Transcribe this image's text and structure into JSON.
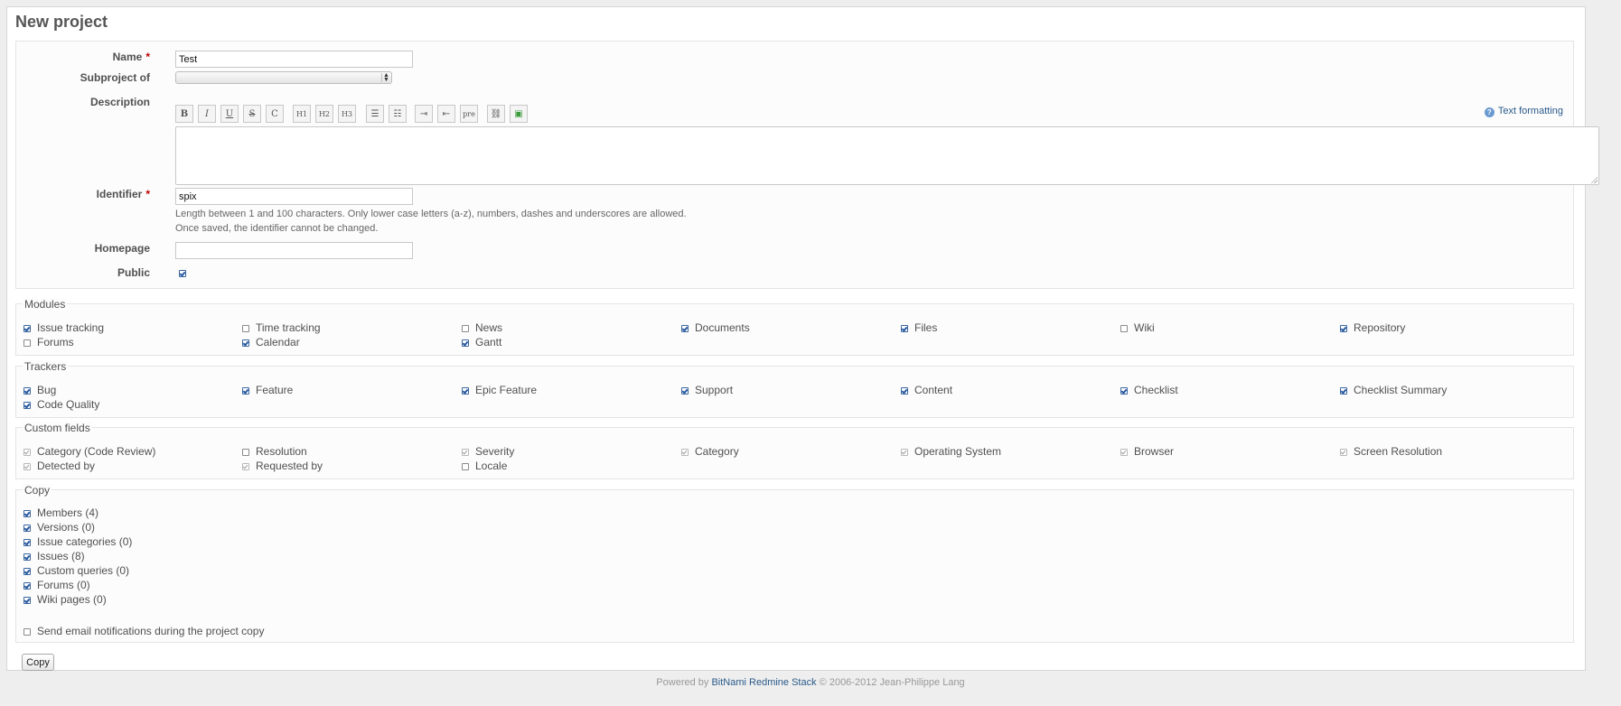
{
  "page": {
    "title": "New project"
  },
  "form": {
    "name_label": "Name",
    "name_value": "Test",
    "required_mark": "*",
    "subproject_label": "Subproject of",
    "subproject_value": "",
    "description_label": "Description",
    "toolbar": [
      "B",
      "I",
      "U",
      "S",
      "C",
      "H1",
      "H2",
      "H3",
      "ul",
      "ol",
      "indent",
      "outdent",
      "pre",
      "link",
      "image"
    ],
    "text_formatting": "Text formatting",
    "description_value": "",
    "identifier_label": "Identifier",
    "identifier_value": "spix",
    "identifier_help1": "Length between 1 and 100 characters. Only lower case letters (a-z), numbers, dashes and underscores are allowed.",
    "identifier_help2": "Once saved, the identifier cannot be changed.",
    "homepage_label": "Homepage",
    "homepage_value": "",
    "public_label": "Public",
    "public_checked": true
  },
  "modules": {
    "legend": "Modules",
    "items": [
      {
        "label": "Issue tracking",
        "checked": true
      },
      {
        "label": "Time tracking",
        "checked": false
      },
      {
        "label": "News",
        "checked": false
      },
      {
        "label": "Documents",
        "checked": true
      },
      {
        "label": "Files",
        "checked": true
      },
      {
        "label": "Wiki",
        "checked": false
      },
      {
        "label": "Repository",
        "checked": true
      },
      {
        "label": "Forums",
        "checked": false
      },
      {
        "label": "Calendar",
        "checked": true
      },
      {
        "label": "Gantt",
        "checked": true
      }
    ]
  },
  "trackers": {
    "legend": "Trackers",
    "items": [
      {
        "label": "Bug",
        "checked": true
      },
      {
        "label": "Feature",
        "checked": true
      },
      {
        "label": "Epic Feature",
        "checked": true
      },
      {
        "label": "Support",
        "checked": true
      },
      {
        "label": "Content",
        "checked": true
      },
      {
        "label": "Checklist",
        "checked": true
      },
      {
        "label": "Checklist Summary",
        "checked": true
      },
      {
        "label": "Code Quality",
        "checked": true
      }
    ]
  },
  "custom_fields": {
    "legend": "Custom fields",
    "items": [
      {
        "label": "Category (Code Review)",
        "checked": true,
        "disabled": true
      },
      {
        "label": "Resolution",
        "checked": false,
        "disabled": false
      },
      {
        "label": "Severity",
        "checked": true,
        "disabled": true
      },
      {
        "label": "Category",
        "checked": true,
        "disabled": true
      },
      {
        "label": "Operating System",
        "checked": true,
        "disabled": true
      },
      {
        "label": "Browser",
        "checked": true,
        "disabled": true
      },
      {
        "label": "Screen Resolution",
        "checked": true,
        "disabled": true
      },
      {
        "label": "Detected by",
        "checked": true,
        "disabled": true
      },
      {
        "label": "Requested by",
        "checked": true,
        "disabled": true
      },
      {
        "label": "Locale",
        "checked": false,
        "disabled": false
      }
    ]
  },
  "copy": {
    "legend": "Copy",
    "items": [
      {
        "label": "Members (4)",
        "checked": true
      },
      {
        "label": "Versions (0)",
        "checked": true
      },
      {
        "label": "Issue categories (0)",
        "checked": true
      },
      {
        "label": "Issues (8)",
        "checked": true
      },
      {
        "label": "Custom queries (0)",
        "checked": true
      },
      {
        "label": "Forums (0)",
        "checked": true
      },
      {
        "label": "Wiki pages (0)",
        "checked": true
      }
    ],
    "notify_label": "Send email notifications during the project copy",
    "notify_checked": false,
    "button_label": "Copy"
  },
  "footer": {
    "prefix": "Powered by",
    "link": "BitNami Redmine Stack",
    "suffix": "© 2006-2012 Jean-Philippe Lang"
  }
}
